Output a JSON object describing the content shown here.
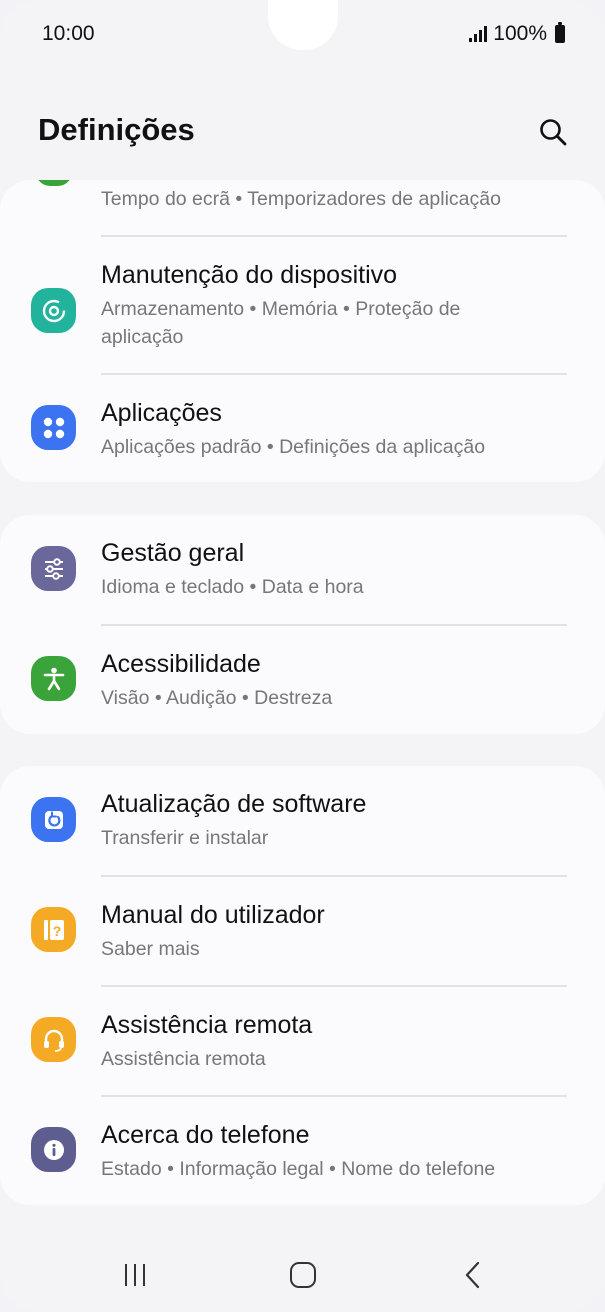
{
  "status": {
    "time": "10:00",
    "battery": "100%"
  },
  "header": {
    "title": "Definições"
  },
  "partial_row": {
    "subtitle": "Tempo do ecrã  •  Temporizadores de aplicação"
  },
  "items": [
    {
      "title": "Manutenção do dispositivo",
      "subtitle": "Armazenamento  •  Memória  •  Proteção de aplicação",
      "icon": "device-care-icon",
      "color": "#22b39c"
    },
    {
      "title": "Aplicações",
      "subtitle": "Aplicações padrão  •  Definições da aplicação",
      "icon": "apps-icon",
      "color": "#3b73f0"
    },
    {
      "title": "Gestão geral",
      "subtitle": "Idioma e teclado  •  Data e hora",
      "icon": "general-management-icon",
      "color": "#6a679b"
    },
    {
      "title": "Acessibilidade",
      "subtitle": "Visão  •  Audição  •  Destreza",
      "icon": "accessibility-icon",
      "color": "#3aa33a"
    },
    {
      "title": "Atualização de software",
      "subtitle": "Transferir e instalar",
      "icon": "software-update-icon",
      "color": "#3b73f0"
    },
    {
      "title": "Manual do utilizador",
      "subtitle": "Saber mais",
      "icon": "user-manual-icon",
      "color": "#f4aa24"
    },
    {
      "title": "Assistência remota",
      "subtitle": "Assistência remota",
      "icon": "remote-support-icon",
      "color": "#f4aa24"
    },
    {
      "title": "Acerca do telefone",
      "subtitle": "Estado  •  Informação legal  •  Nome do telefone",
      "icon": "about-phone-icon",
      "color": "#5d5d8f"
    }
  ]
}
